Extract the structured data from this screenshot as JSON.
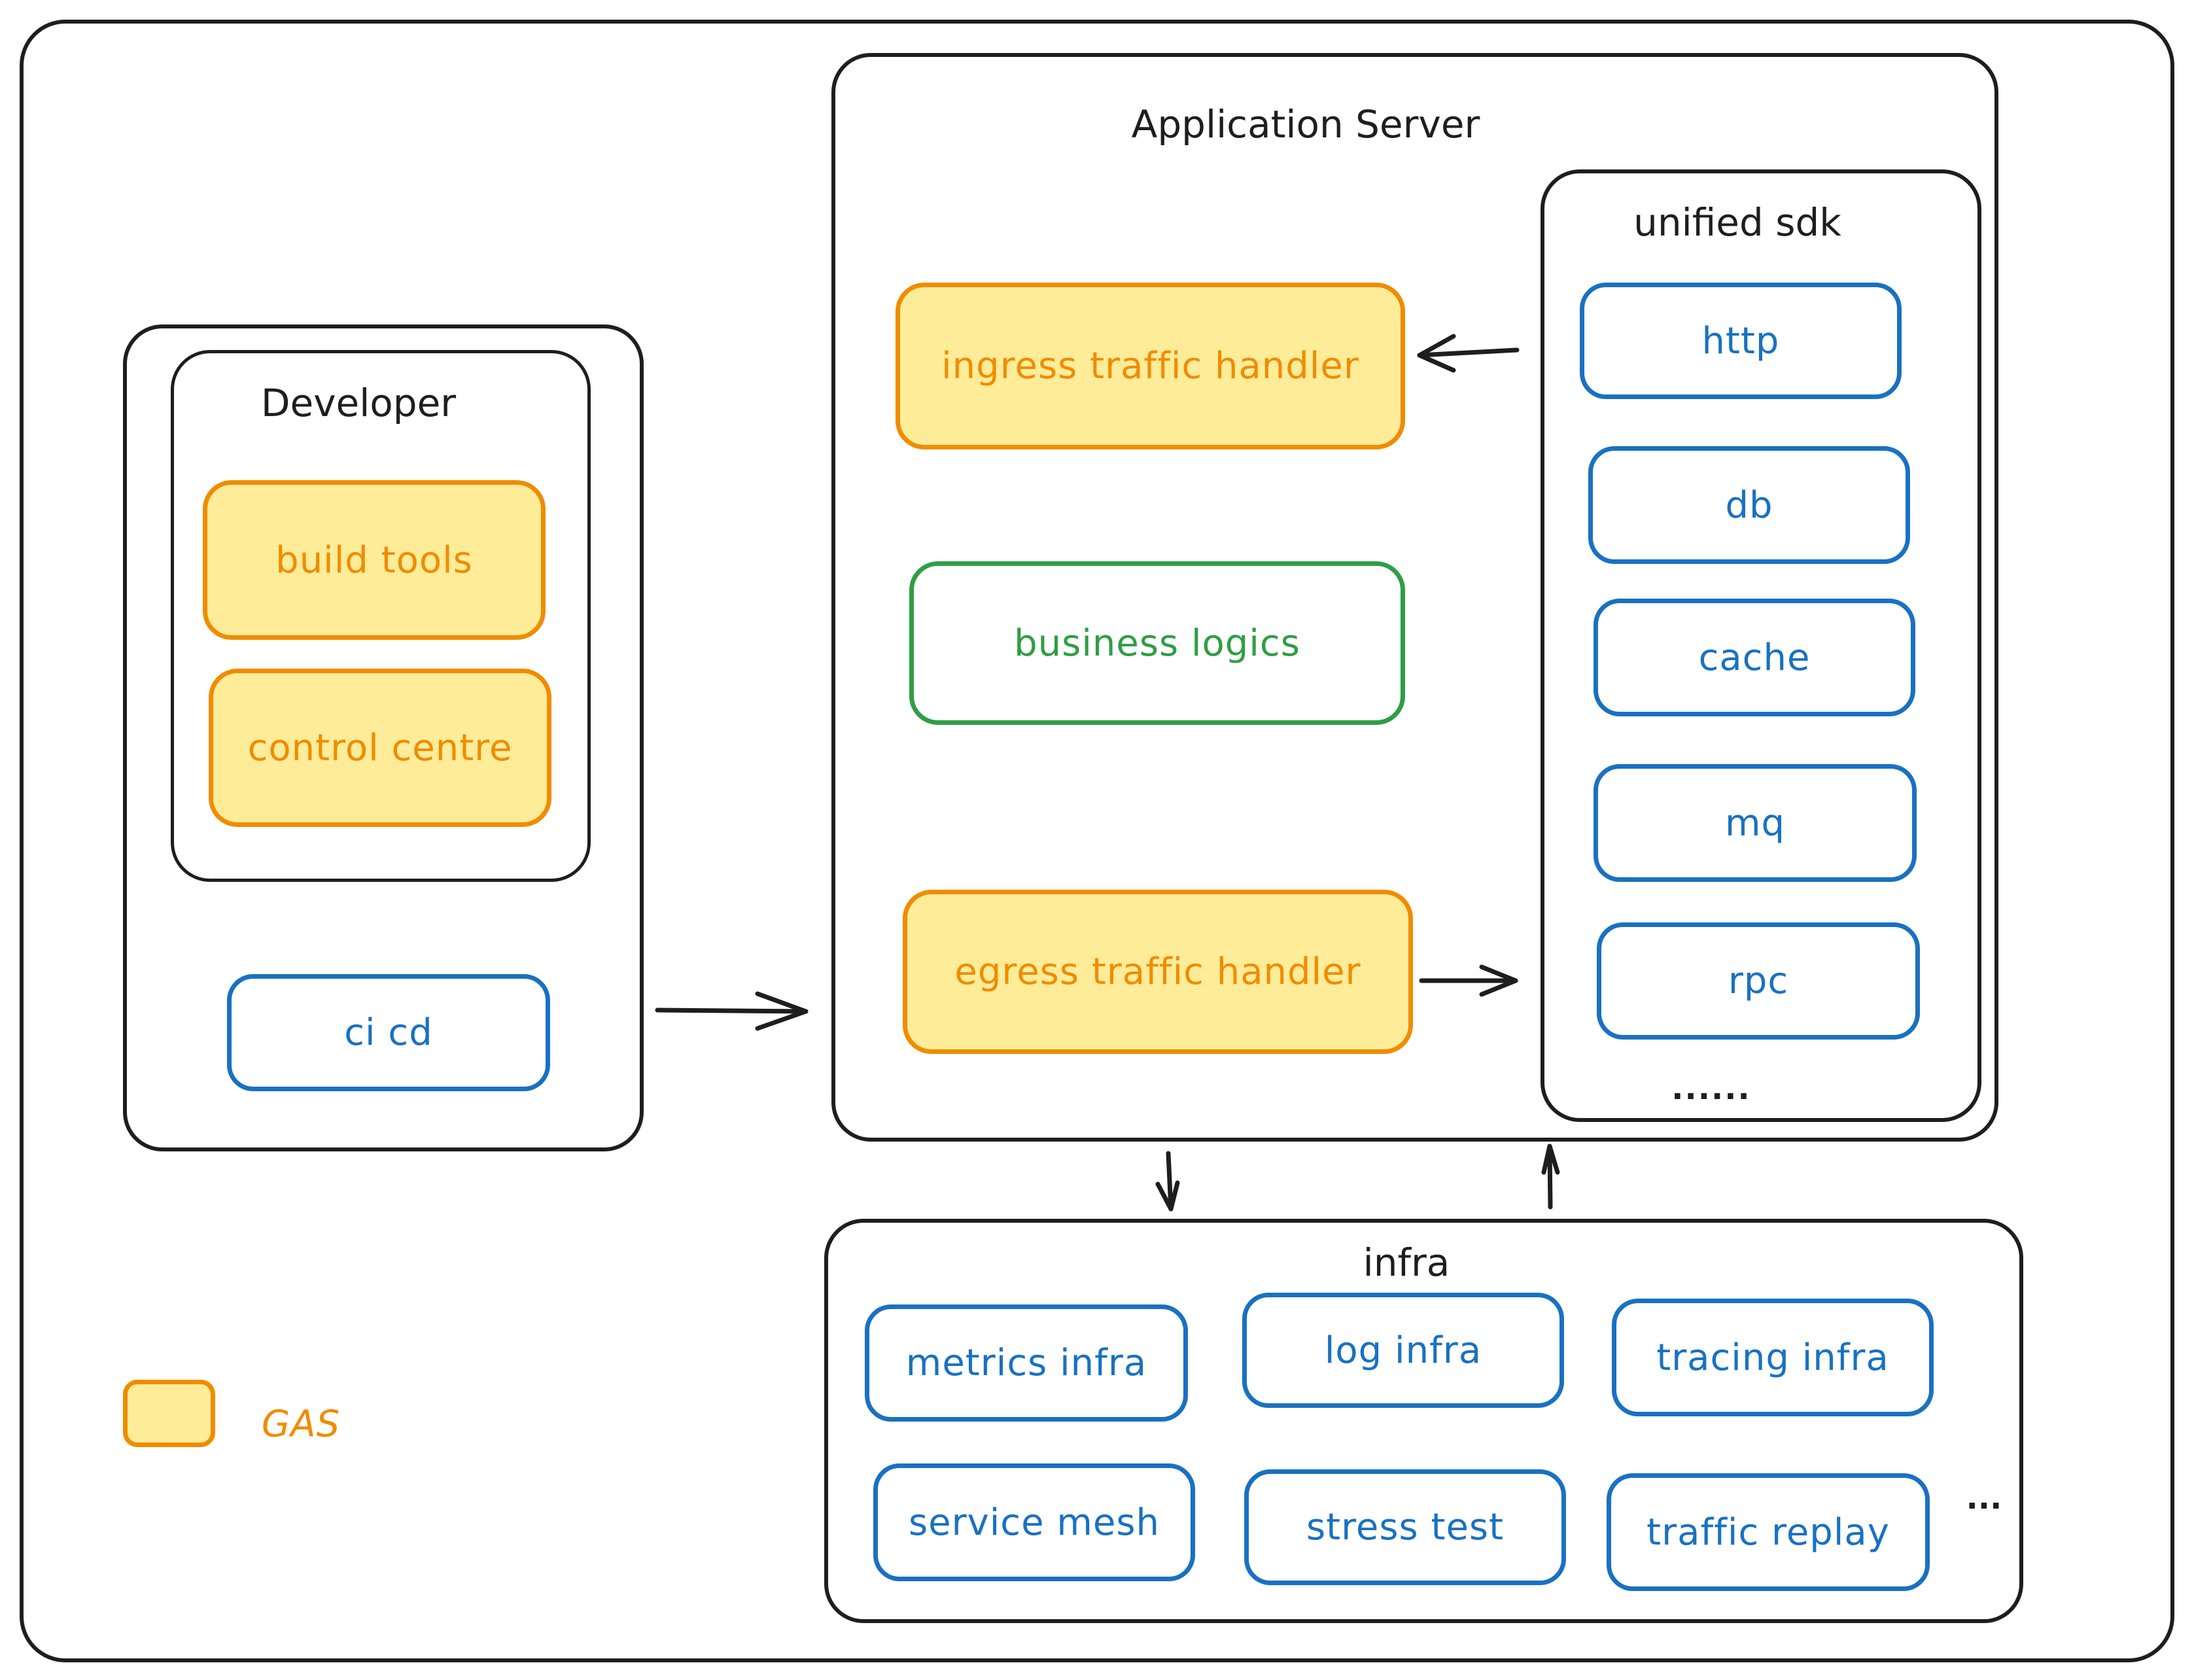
{
  "diagram": {
    "legend": {
      "label": "GAS",
      "swatch_fill": "#ffec99",
      "swatch_stroke": "#f08c00"
    },
    "developer": {
      "title": "Developer",
      "items": [
        {
          "label": "build tools",
          "style": "gas"
        },
        {
          "label": "control centre",
          "style": "gas"
        }
      ],
      "cicd": {
        "label": "ci cd",
        "style": "blue"
      }
    },
    "application_server": {
      "title": "Application Server",
      "ingress": {
        "label": "ingress traffic handler",
        "style": "gas"
      },
      "business": {
        "label": "business logics",
        "style": "green"
      },
      "egress": {
        "label": "egress traffic handler",
        "style": "gas"
      },
      "unified_sdk": {
        "title": "unified sdk",
        "items": [
          {
            "label": "http"
          },
          {
            "label": "db"
          },
          {
            "label": "cache"
          },
          {
            "label": "mq"
          },
          {
            "label": "rpc"
          }
        ],
        "more": "......"
      }
    },
    "infra": {
      "title": "infra",
      "items": [
        {
          "label": "metrics infra"
        },
        {
          "label": "log infra"
        },
        {
          "label": "tracing infra"
        },
        {
          "label": "service mesh"
        },
        {
          "label": "stress test"
        },
        {
          "label": "traffic replay"
        }
      ],
      "more": "..."
    },
    "colors": {
      "stroke": "#1e1e1e",
      "gas_stroke": "#f08c00",
      "gas_fill": "#ffec99",
      "blue": "#1971c2",
      "green": "#2f9e44"
    },
    "connections": [
      {
        "from": "developer",
        "to": "application_server"
      },
      {
        "from": "unified_sdk.http",
        "to": "ingress traffic handler"
      },
      {
        "from": "egress traffic handler",
        "to": "unified_sdk.rpc"
      },
      {
        "from": "application_server",
        "to": "infra"
      },
      {
        "from": "infra",
        "to": "application_server"
      }
    ]
  }
}
